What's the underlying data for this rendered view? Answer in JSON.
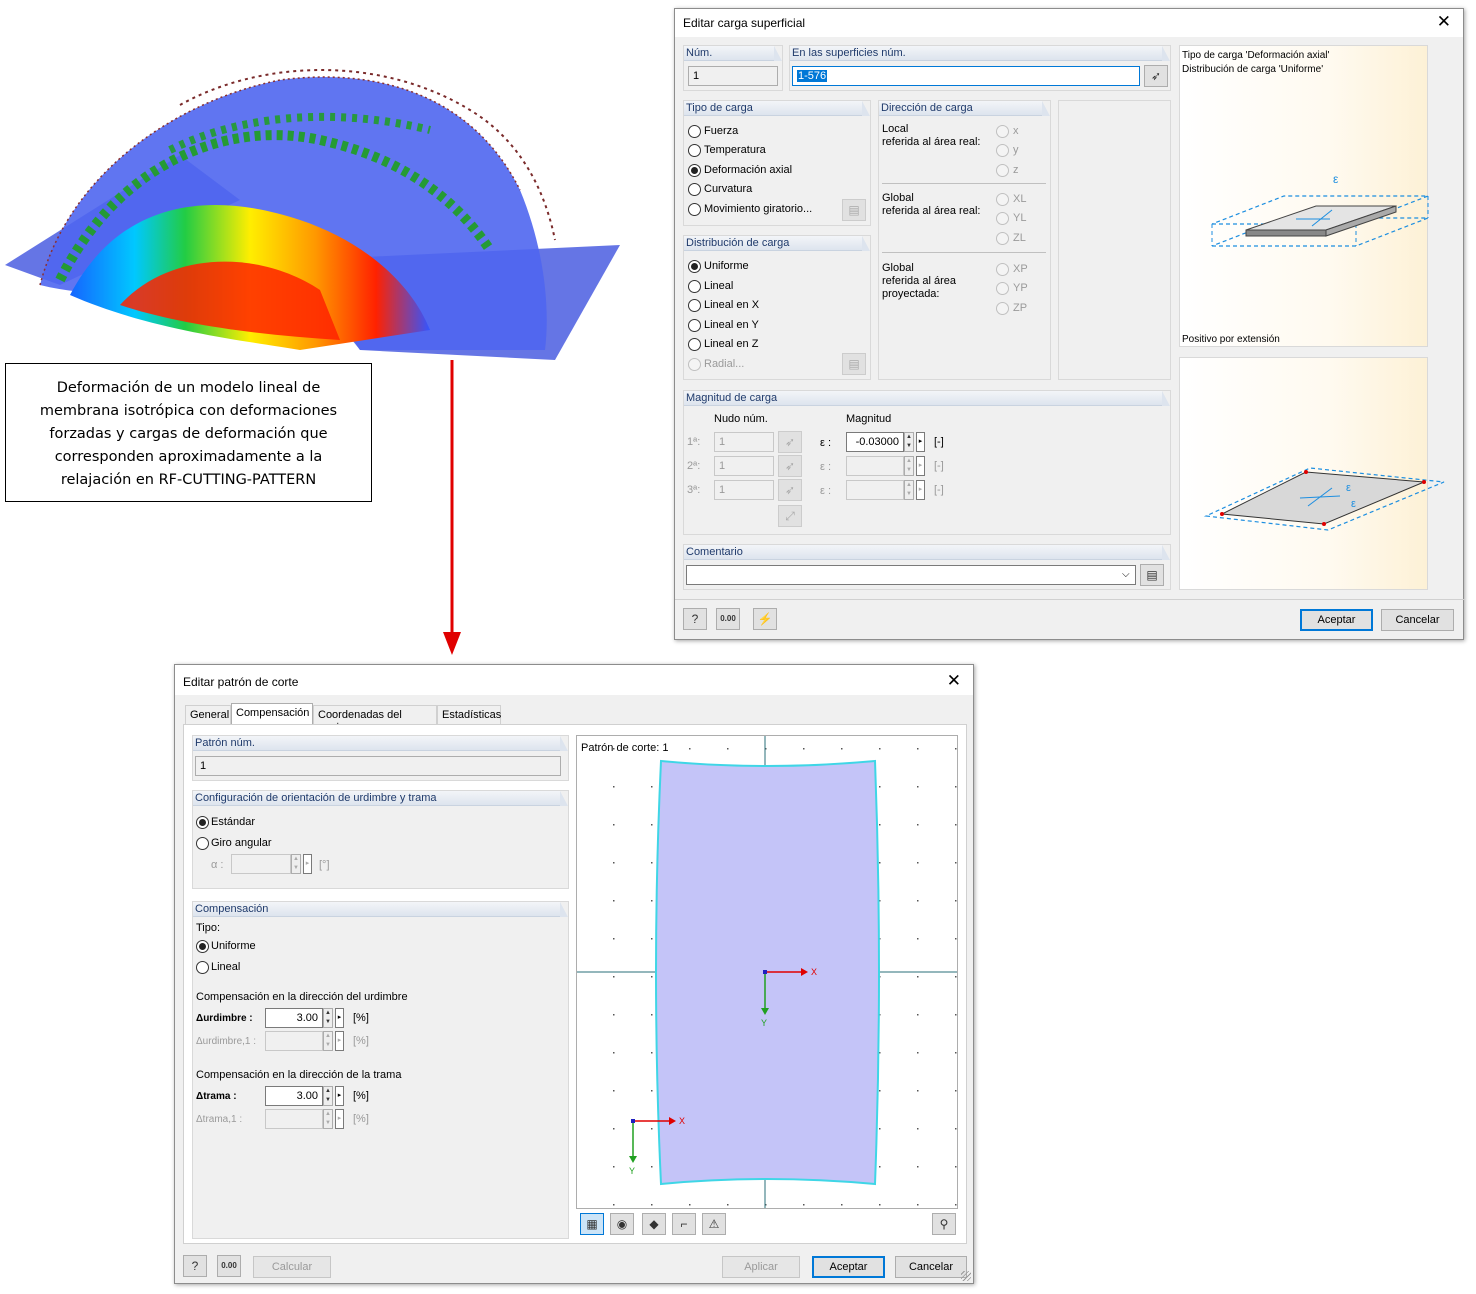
{
  "note": {
    "lines": [
      "Deformación de un modelo lineal de",
      "membrana isotrópica con deformaciones",
      "forzadas y cargas de deformación que",
      "corresponden aproximadamente a la",
      "relajación en RF-CUTTING-PATTERN"
    ]
  },
  "load_dialog": {
    "title": "Editar carga superficial",
    "num_label": "Núm.",
    "num_value": "1",
    "surfaces_label": "En las superficies núm.",
    "surfaces_value": "1-576",
    "load_type": {
      "header": "Tipo de carga",
      "options": [
        "Fuerza",
        "Temperatura",
        "Deformación axial",
        "Curvatura",
        "Movimiento giratorio..."
      ],
      "selected": "Deformación axial"
    },
    "load_direction": {
      "header": "Dirección de carga",
      "local_label_1": "Local",
      "local_label_2": "referida al área real:",
      "local_opts": [
        "x",
        "y",
        "z"
      ],
      "global_label_1": "Global",
      "global_label_2": "referida al área real:",
      "global_opts": [
        "XL",
        "YL",
        "ZL"
      ],
      "proj_label_1": "Global",
      "proj_label_2": "referida al área",
      "proj_label_3": "proyectada:",
      "proj_opts": [
        "XP",
        "YP",
        "ZP"
      ]
    },
    "load_distribution": {
      "header": "Distribución de carga",
      "options": [
        "Uniforme",
        "Lineal",
        "Lineal en X",
        "Lineal en Y",
        "Lineal en Z",
        "Radial..."
      ],
      "selected": "Uniforme"
    },
    "load_magnitude": {
      "header": "Magnitud de carga",
      "node_col": "Nudo núm.",
      "mag_col": "Magnitud",
      "rows": [
        {
          "label": "1ª:",
          "node": "1",
          "eps": "ε :",
          "value": "-0.03000",
          "unit": "[-]"
        },
        {
          "label": "2ª:",
          "node": "1",
          "eps": "ε :",
          "value": "",
          "unit": "[-]"
        },
        {
          "label": "3ª:",
          "node": "1",
          "eps": "ε :",
          "value": "",
          "unit": "[-]"
        }
      ]
    },
    "comment_label": "Comentario",
    "preview_line1": "Tipo de carga 'Deformación axial'",
    "preview_line2": "Distribución de carga 'Uniforme'",
    "preview_caption": "Positivo por extensión",
    "eps_symbol": "ε",
    "accept": "Aceptar",
    "cancel": "Cancelar",
    "zero_icon": "0.00"
  },
  "pattern_dialog": {
    "title": "Editar patrón de corte",
    "tabs": [
      "General",
      "Compensación",
      "Coordenadas del punto",
      "Estadísticas"
    ],
    "active_tab": "Compensación",
    "pattern_header": "Patrón núm.",
    "pattern_value": "1",
    "orientation": {
      "header": "Configuración de orientación de urdimbre y trama",
      "options": [
        "Estándar",
        "Giro angular"
      ],
      "selected": "Estándar",
      "alpha_label": "α :",
      "alpha_unit": "[°]"
    },
    "compensation": {
      "header": "Compensación",
      "type_label": "Tipo:",
      "options": [
        "Uniforme",
        "Lineal"
      ],
      "selected": "Uniforme",
      "warp_title": "Compensación en la dirección del urdimbre",
      "warp_label": "Δurdimbre :",
      "warp_value": "3.00",
      "warp1_label": "Δurdimbre,1 :",
      "weft_title": "Compensación en la dirección de la trama",
      "weft_label": "Δtrama :",
      "weft_value": "3.00",
      "weft1_label": "Δtrama,1 :",
      "unit": "[%]"
    },
    "preview_label": "Patrón de corte: 1",
    "axis_x": "X",
    "axis_y": "Y",
    "calc": "Calcular",
    "apply": "Aplicar",
    "accept": "Aceptar",
    "cancel": "Cancelar",
    "zero_icon": "0.00",
    "pattern_fill": "#c4c4f8",
    "pattern_stroke": "#3fd6e6"
  },
  "colors": {
    "arrow": "#e00000",
    "header_text": "#1f3a6b",
    "accent": "#0078d7"
  }
}
